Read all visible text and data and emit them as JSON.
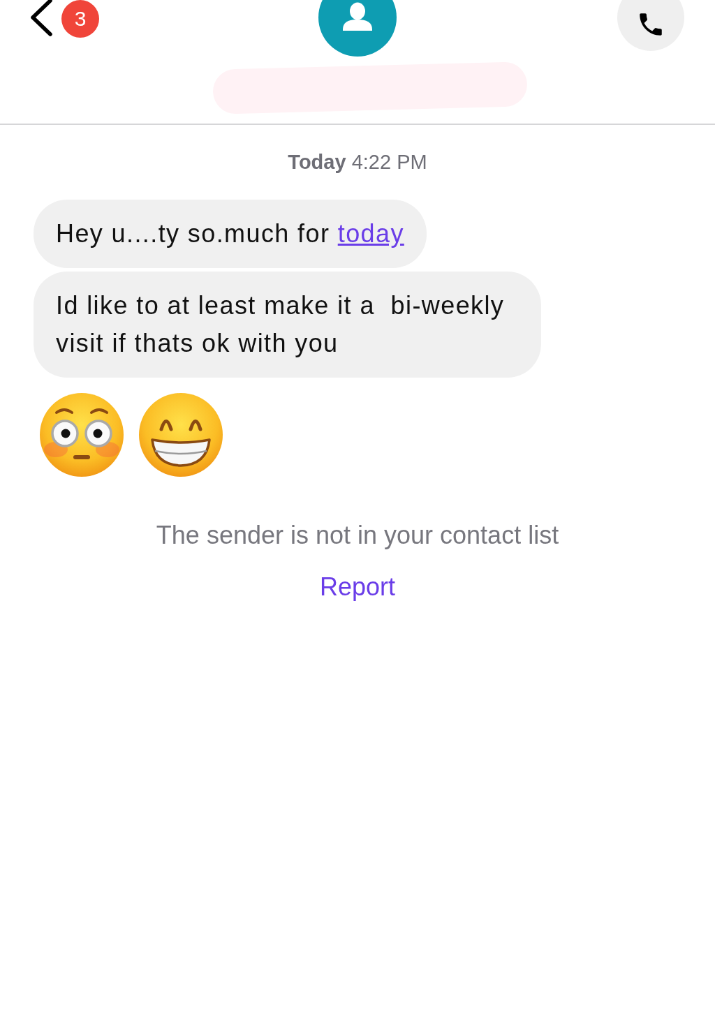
{
  "header": {
    "unread_badge": "3"
  },
  "timestamp": "**Today** 4:22 PM",
  "messages": [
    {
      "text": "Hey u....ty so.much for",
      "link": "today"
    },
    {
      "text": "Id like to at least make it a  bi-weekly visit if thats ok with you"
    }
  ],
  "emojis": [
    {
      "kind": "flushed"
    },
    {
      "kind": "beaming"
    }
  ],
  "notice": {
    "text": "The sender is not in your contact list",
    "action": "Report"
  }
}
